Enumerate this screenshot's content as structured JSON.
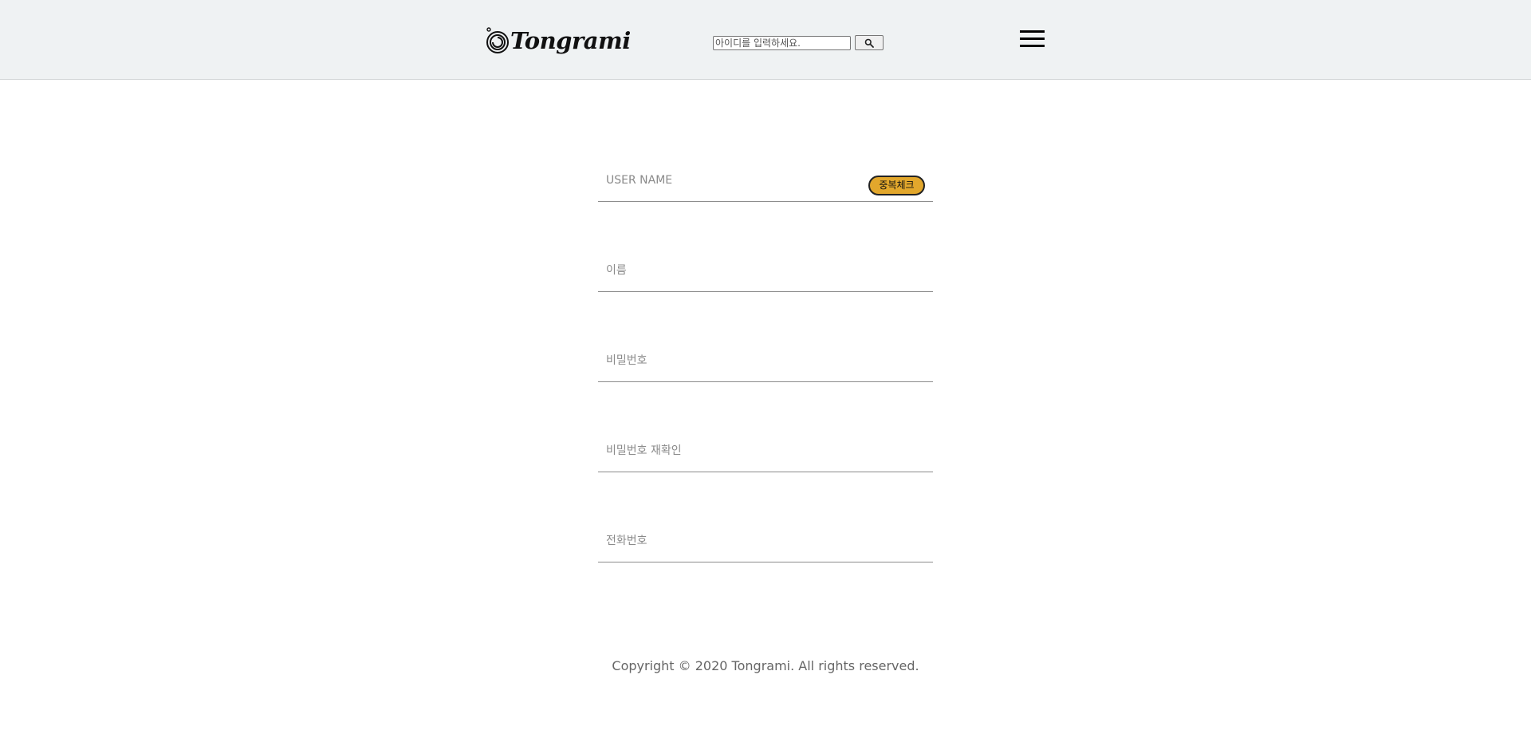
{
  "header": {
    "logo_text": "Tongrami",
    "logo_icon": "camera-swirl-icon",
    "search": {
      "placeholder": "아이디를 입력하세요.",
      "button_icon": "search-icon"
    },
    "menu_icon": "hamburger-menu-icon"
  },
  "form": {
    "username_placeholder": "USER NAME",
    "duplicate_check_label": "중복체크",
    "name_placeholder": "이름",
    "password_placeholder": "비밀번호",
    "password_confirm_placeholder": "비밀번호 재확인",
    "phone_placeholder": "전화번호"
  },
  "footer": {
    "copyright": "Copyright © 2020 Tongrami. All rights reserved."
  },
  "colors": {
    "header_bg": "#eff2f3",
    "accent_button": "#e2a72c"
  }
}
